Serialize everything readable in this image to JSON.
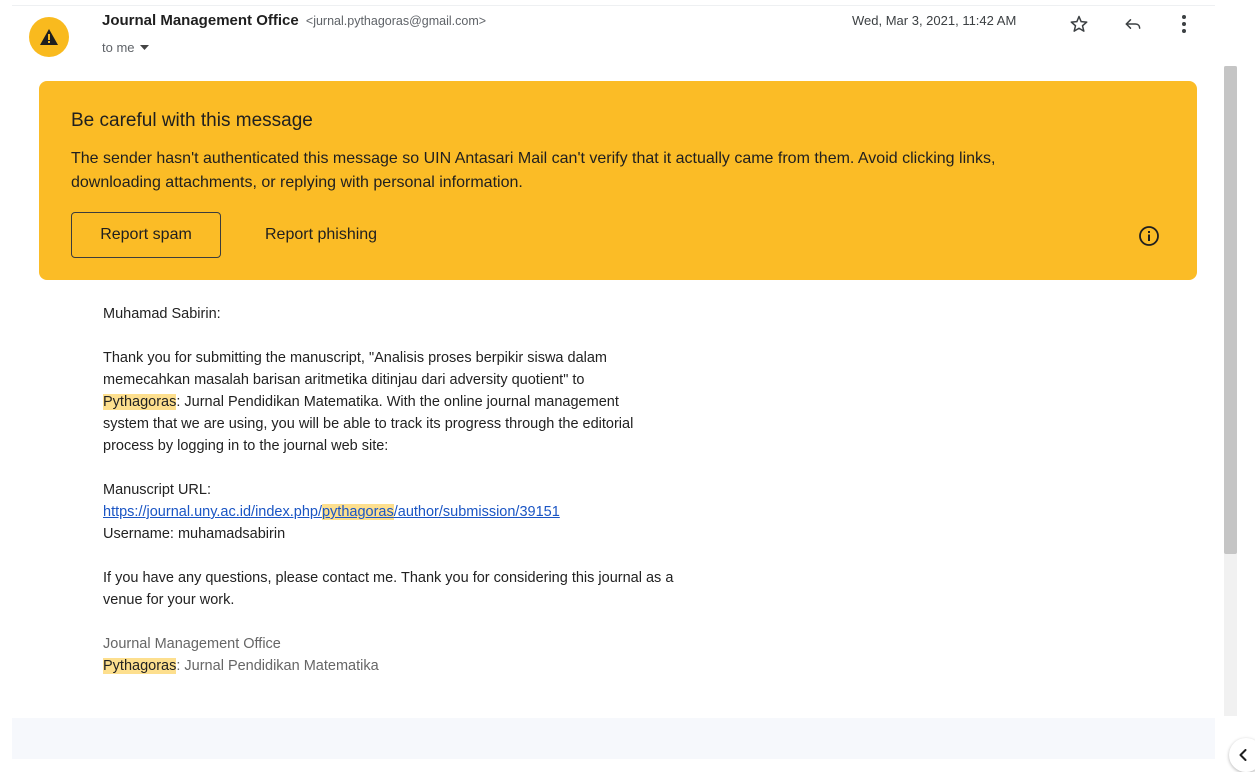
{
  "message": {
    "sender_name": "Journal Management Office",
    "sender_email": "<jurnal.pythagoras@gmail.com>",
    "recipient": "to me",
    "date": "Wed, Mar 3, 2021, 11:42 AM"
  },
  "warning": {
    "title": "Be careful with this message",
    "body_line1": "The sender hasn't authenticated this message so UIN Antasari Mail can't verify that it actually came from them. Avoid clicking links,",
    "body_line2": "downloading attachments, or replying with personal information.",
    "report_spam_label": "Report spam",
    "report_phishing_label": "Report phishing",
    "color": "#fbbc26"
  },
  "body": {
    "greeting": "Muhamad Sabirin:",
    "para1_part1": "Thank you for submitting the manuscript, \"Analisis proses berpikir siswa dalam memecahkan masalah barisan aritmetika ditinjau dari adversity quotient\" to ",
    "para1_highlight": "Pythagoras",
    "para1_part2": ": Jurnal Pendidikan Matematika. With the online journal management system that we are using, you will be able to track its progress through the editorial process by logging in to the journal web site:",
    "manuscript_url_label": "Manuscript URL:",
    "url_part1": "https://journal.uny.ac.id/index.php/",
    "url_highlight": "pythagoras",
    "url_part2": "/author/submission/39151",
    "username_line": "Username: muhamadsabirin",
    "closing": "If you have any questions, please contact me. Thank you for considering this journal as a venue for your work.",
    "signature_line1": "Journal Management Office",
    "signature_highlight": "Pythagoras",
    "signature_line2_rest": ": Jurnal Pendidikan Matematika"
  },
  "icons": {
    "avatar": "warning-triangle-icon",
    "star": "star-icon",
    "reply": "reply-icon",
    "more": "more-vert-icon",
    "info": "info-icon",
    "dropdown": "caret-down-icon",
    "side": "chevron-left-icon"
  }
}
